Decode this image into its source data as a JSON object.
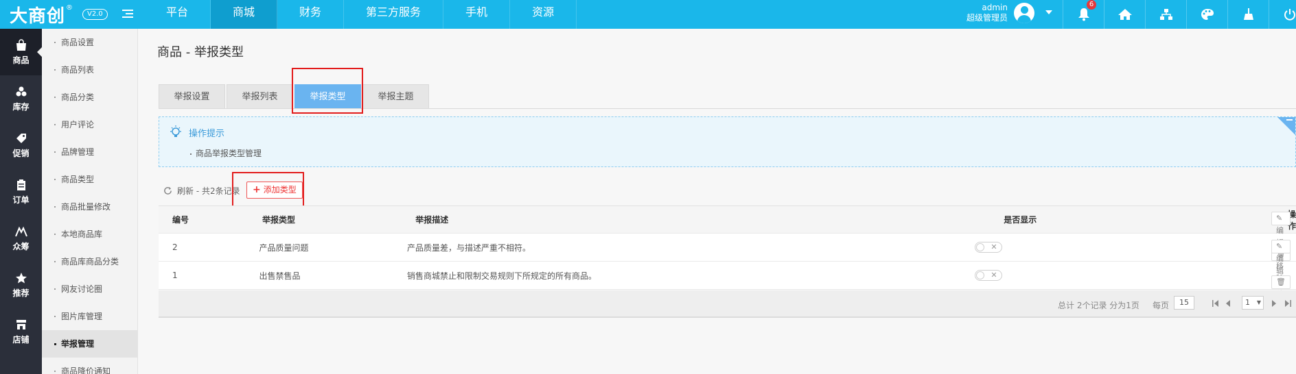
{
  "header": {
    "logo": "大商创",
    "logo_reg": "®",
    "version": "V2.0",
    "nav": [
      "平台",
      "商城",
      "财务",
      "第三方服务",
      "手机",
      "资源"
    ],
    "active_nav": "商城",
    "admin_name": "admin",
    "admin_role": "超级管理员",
    "notification_count": "6",
    "icons": [
      "bell-icon",
      "home-icon",
      "sitemap-icon",
      "palette-icon",
      "broom-icon",
      "power-icon"
    ]
  },
  "rail": {
    "items": [
      {
        "label": "商品",
        "icon": "shopping-bag-icon"
      },
      {
        "label": "库存",
        "icon": "stack-icon"
      },
      {
        "label": "促销",
        "icon": "tag-icon"
      },
      {
        "label": "订单",
        "icon": "clipboard-icon"
      },
      {
        "label": "众筹",
        "icon": "people-icon"
      },
      {
        "label": "推荐",
        "icon": "star-icon"
      },
      {
        "label": "店铺",
        "icon": "store-icon"
      }
    ],
    "active": "商品"
  },
  "submenu": {
    "items": [
      "商品设置",
      "商品列表",
      "商品分类",
      "用户评论",
      "品牌管理",
      "商品类型",
      "商品批量修改",
      "本地商品库",
      "商品库商品分类",
      "网友讨论圈",
      "图片库管理",
      "举报管理",
      "商品降价通知"
    ],
    "active": "举报管理"
  },
  "main": {
    "title": "商品 - 举报类型",
    "tabs": [
      "举报设置",
      "举报列表",
      "举报类型",
      "举报主题"
    ],
    "active_tab": "举报类型",
    "tips_title": "操作提示",
    "tips_line": "商品举报类型管理",
    "refresh_text": "刷新 - 共2条记录",
    "add_button": "添加类型",
    "table": {
      "headers": [
        "编号",
        "举报类型",
        "举报描述",
        "是否显示",
        "操作"
      ],
      "rows": [
        {
          "id": "2",
          "type": "产品质量问题",
          "desc": "产品质量差，与描述严重不相符。"
        },
        {
          "id": "1",
          "type": "出售禁售品",
          "desc": "销售商城禁止和限制交易规则下所规定的所有商品。"
        }
      ],
      "edit_label": "编辑",
      "remove_label": "移除"
    },
    "footer": {
      "summary": "总计 2个记录 分为1页",
      "perpage_label": "每页",
      "perpage_value": "15",
      "page_value": "1"
    }
  },
  "colors": {
    "topbar": "#1ab7ea",
    "active_tab": "#6ab4f0",
    "highlight": "#e21b1b",
    "rail": "#2b2f3a"
  }
}
